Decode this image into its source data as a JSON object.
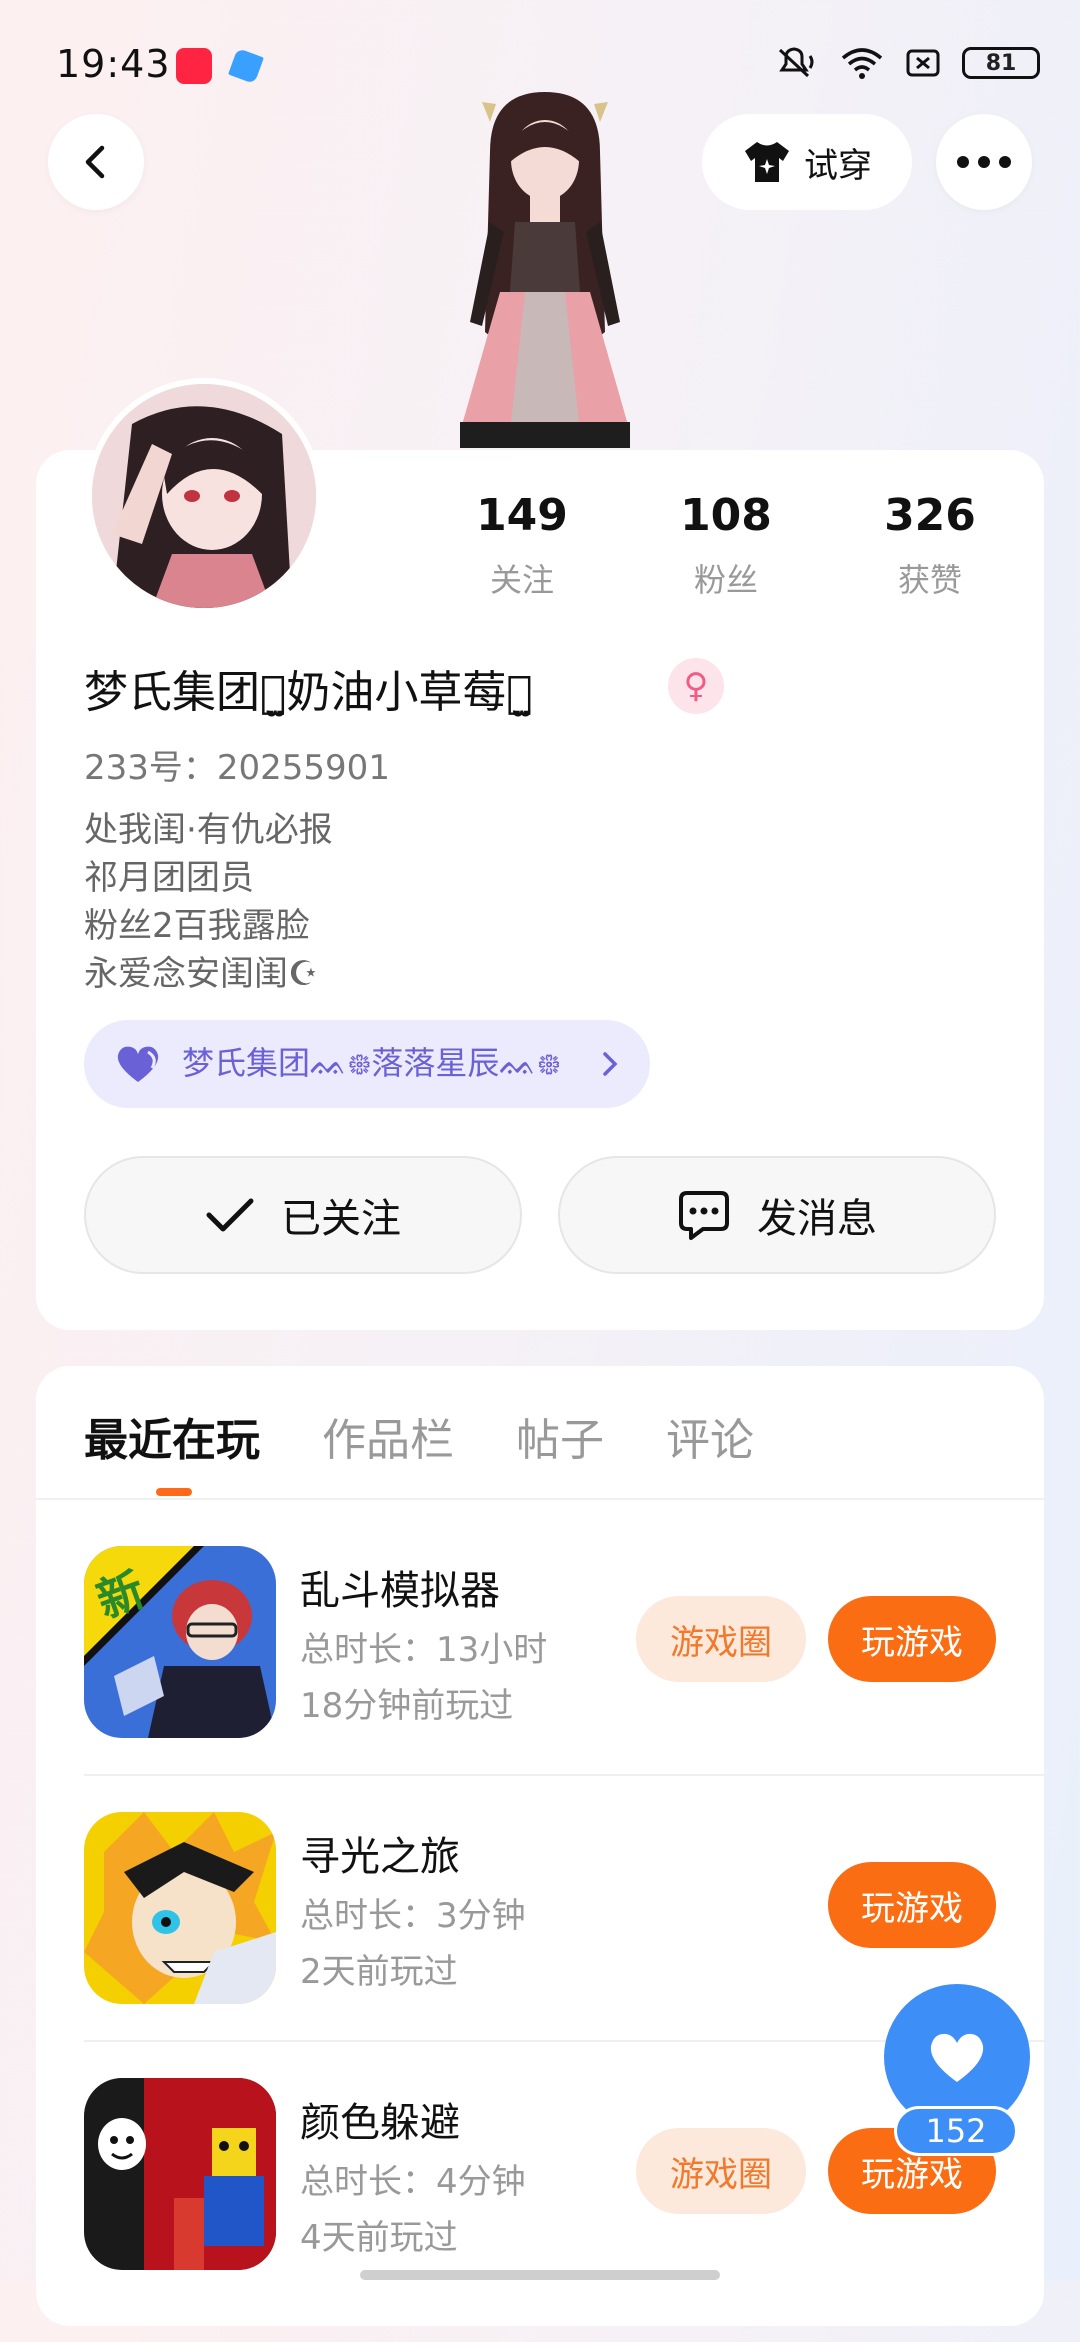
{
  "status_bar": {
    "time": "19:43",
    "battery": "81",
    "icons": [
      "xiaohongshu-app-icon",
      "app-icon",
      "mute-icon",
      "wifi-icon",
      "sim-icon",
      "battery-icon"
    ]
  },
  "header": {
    "try_on_label": "试穿"
  },
  "profile": {
    "stats": [
      {
        "value": "149",
        "label": "关注"
      },
      {
        "value": "108",
        "label": "粉丝"
      },
      {
        "value": "326",
        "label": "获赞"
      }
    ],
    "nickname": "梦氏集团ꪔ̤̫奶油小草莓ꪔ̤̫",
    "gender_symbol": "♀",
    "uid": "233号：20255901",
    "bio": [
      "处我闺·有仇必报",
      "祁月团团员",
      "粉丝2百我露脸",
      "永爱念安闺闺☪"
    ],
    "group": "梦氏集团ᨐ᪥落落星辰ᨐ᪥",
    "follow_label": "已关注",
    "message_label": "发消息"
  },
  "tabs": [
    {
      "label": "最近在玩",
      "active": true
    },
    {
      "label": "作品栏",
      "active": false
    },
    {
      "label": "帖子",
      "active": false
    },
    {
      "label": "评论",
      "active": false
    }
  ],
  "games": [
    {
      "name": "乱斗模拟器",
      "duration": "总时长：13小时",
      "last_played": "18分钟前玩过",
      "circle_label": "游戏圈",
      "play_label": "玩游戏",
      "badge": "新"
    },
    {
      "name": "寻光之旅",
      "duration": "总时长：3分钟",
      "last_played": "2天前玩过",
      "circle_label": "",
      "play_label": "玩游戏"
    },
    {
      "name": "颜色躲避",
      "duration": "总时长：4分钟",
      "last_played": "4天前玩过",
      "circle_label": "游戏圈",
      "play_label": "玩游戏"
    }
  ],
  "like": {
    "count": "152"
  },
  "colors": {
    "accent_orange": "#fb6d12",
    "like_blue": "#3d8ef7",
    "group_purple": "#6b61d6"
  }
}
